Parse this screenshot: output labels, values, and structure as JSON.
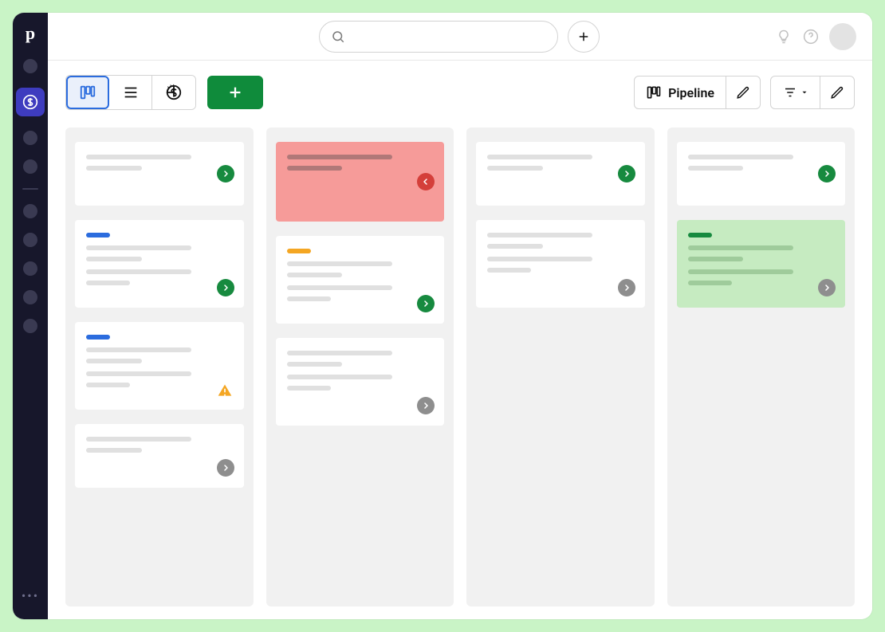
{
  "app": {
    "brand_letter": "p"
  },
  "nav": {
    "active_icon": "dollar-icon",
    "more_label": "•••"
  },
  "topbar": {
    "search_placeholder": "",
    "add_label": "+"
  },
  "toolbar": {
    "views": {
      "kanban": "kanban-icon",
      "list": "list-icon",
      "forecast": "forecast-icon"
    },
    "add_deal_label": "+",
    "pipeline_label": "Pipeline"
  },
  "board": {
    "columns": [
      {
        "id": "col1",
        "cards": [
          {
            "tag": null,
            "status": "green",
            "status_pos": "center-y",
            "variant": "white",
            "title": "",
            "subtitle": ""
          },
          {
            "tag": "blue",
            "status": "green",
            "status_pos": "bottom",
            "variant": "white",
            "title": "",
            "subtitle": "",
            "extra": true
          },
          {
            "tag": "blue",
            "warning": true,
            "variant": "white",
            "title": "",
            "subtitle": "",
            "extra": true
          },
          {
            "tag": null,
            "status": "grey",
            "status_pos": "bottom",
            "variant": "white",
            "title": "",
            "subtitle": ""
          }
        ]
      },
      {
        "id": "col2",
        "cards": [
          {
            "tag": null,
            "status": "red",
            "status_pos": "center-y",
            "variant": "red",
            "title": "",
            "subtitle": "",
            "tall": true
          },
          {
            "tag": "amber",
            "status": "green",
            "status_pos": "bottom",
            "variant": "white",
            "title": "",
            "subtitle": "",
            "extra": true
          },
          {
            "tag": null,
            "status": "grey",
            "status_pos": "bottom",
            "variant": "white",
            "title": "",
            "subtitle": "",
            "extra": true
          }
        ]
      },
      {
        "id": "col3",
        "cards": [
          {
            "tag": null,
            "status": "green",
            "status_pos": "center-y",
            "variant": "white",
            "title": "",
            "subtitle": ""
          },
          {
            "tag": null,
            "status": "grey",
            "status_pos": "bottom",
            "variant": "white",
            "title": "",
            "subtitle": "",
            "extra": true
          }
        ]
      },
      {
        "id": "col4",
        "cards": [
          {
            "tag": null,
            "status": "green",
            "status_pos": "center-y",
            "variant": "white",
            "title": "",
            "subtitle": ""
          },
          {
            "tag": "dgreen",
            "status": "grey",
            "status_pos": "bottom",
            "variant": "green",
            "title": "",
            "subtitle": "",
            "extra": true
          }
        ]
      }
    ]
  },
  "colors": {
    "accent_green": "#178A3F",
    "accent_red": "#D43F3A",
    "accent_grey": "#8E8E8E",
    "accent_blue": "#2B6CDE",
    "accent_amber": "#F4A623"
  }
}
